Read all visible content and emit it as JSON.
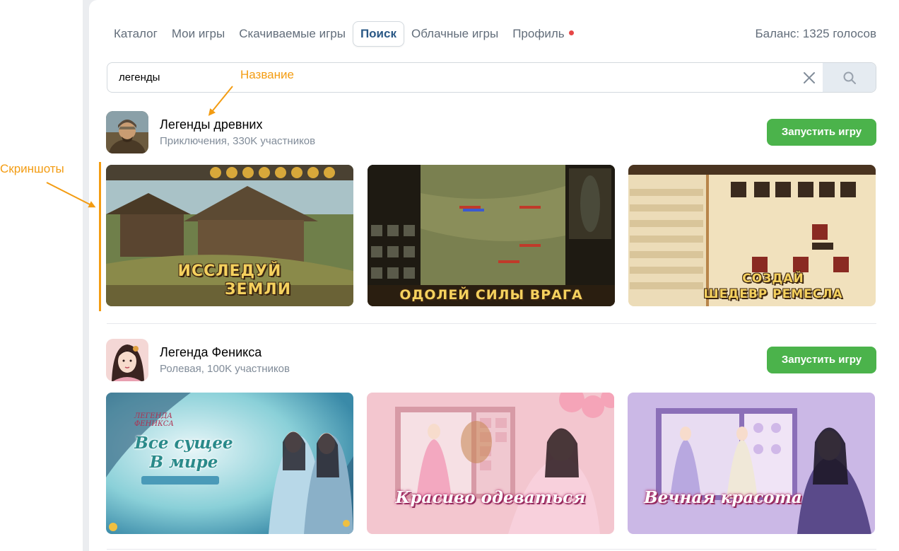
{
  "tabs": [
    {
      "label": "Каталог",
      "active": false
    },
    {
      "label": "Мои игры",
      "active": false
    },
    {
      "label": "Скачиваемые игры",
      "active": false
    },
    {
      "label": "Поиск",
      "active": true
    },
    {
      "label": "Облачные игры",
      "active": false
    },
    {
      "label": "Профиль",
      "active": false,
      "notification_dot": true
    }
  ],
  "balance": "Баланс: 1325 голосов",
  "search": {
    "value": "легенды",
    "clear_icon": "close-icon",
    "button_icon": "search-icon"
  },
  "annotations": {
    "title_label": "Название",
    "screenshots_label": "Скриншоты",
    "color": "#f39c12"
  },
  "games": [
    {
      "title": "Легенды древних",
      "subtitle": "Приключения, 330K участников",
      "launch_label": "Запустить игру",
      "screenshots": [
        {
          "caption_line1": "ИССЛЕДУЙ",
          "caption_line2": "ЗЕМЛИ"
        },
        {
          "caption_line1": "ОДОЛЕЙ СИЛЫ ВРАГА",
          "caption_line2": ""
        },
        {
          "caption_line1": "СОЗДАЙ",
          "caption_line2": "ШЕДЕВР РЕМЕСЛА"
        }
      ]
    },
    {
      "title": "Легенда Феникса",
      "subtitle": "Ролевая, 100K участников",
      "launch_label": "Запустить игру",
      "screenshots": [
        {
          "caption_line1": "Все сущее",
          "caption_line2": "В мире"
        },
        {
          "caption_line1": "Красиво одеваться",
          "caption_line2": ""
        },
        {
          "caption_line1": "Вечная красота",
          "caption_line2": ""
        }
      ]
    }
  ],
  "colors": {
    "accent_green": "#4bb34b",
    "active_tab": "#2a5885",
    "notification_dot": "#e64646"
  }
}
